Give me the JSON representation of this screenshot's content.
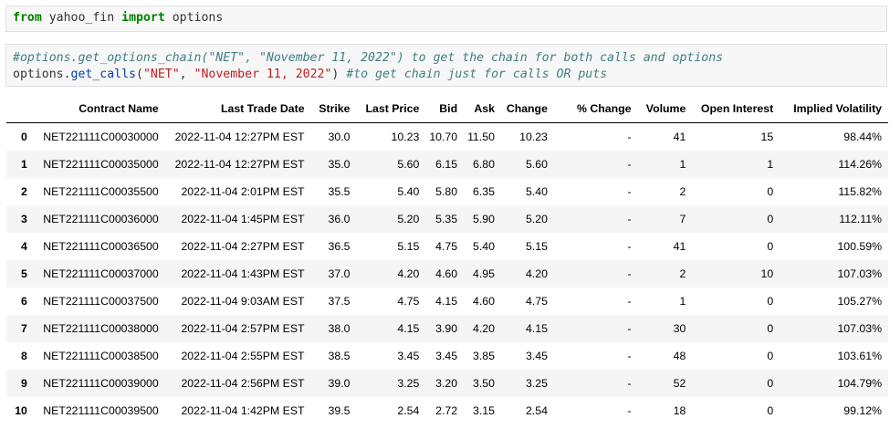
{
  "cells": {
    "import": {
      "kw_from": "from",
      "module": "yahoo_fin",
      "kw_import": "import",
      "name": "options"
    },
    "query": {
      "comment_line": "#options.get_options_chain(\"NET\", \"November 11, 2022\") to get the chain for both calls and options",
      "obj": "options",
      "dot": ".",
      "func": "get_calls",
      "open_paren": "(",
      "arg1": "\"NET\"",
      "sep": ", ",
      "arg2": "\"November 11, 2022\"",
      "close_paren": ") ",
      "comment_inline": "#to get chain just for calls OR puts"
    }
  },
  "table": {
    "columns": [
      "",
      "Contract Name",
      "Last Trade Date",
      "Strike",
      "Last Price",
      "Bid",
      "Ask",
      "Change",
      "% Change",
      "Volume",
      "Open Interest",
      "Implied Volatility"
    ],
    "rows": [
      [
        "0",
        "NET221111C00030000",
        "2022-11-04 12:27PM EST",
        "30.0",
        "10.23",
        "10.70",
        "11.50",
        "10.23",
        "-",
        "41",
        "15",
        "98.44%"
      ],
      [
        "1",
        "NET221111C00035000",
        "2022-11-04 12:27PM EST",
        "35.0",
        "5.60",
        "6.15",
        "6.80",
        "5.60",
        "-",
        "1",
        "1",
        "114.26%"
      ],
      [
        "2",
        "NET221111C00035500",
        "2022-11-04 2:01PM EST",
        "35.5",
        "5.40",
        "5.80",
        "6.35",
        "5.40",
        "-",
        "2",
        "0",
        "115.82%"
      ],
      [
        "3",
        "NET221111C00036000",
        "2022-11-04 1:45PM EST",
        "36.0",
        "5.20",
        "5.35",
        "5.90",
        "5.20",
        "-",
        "7",
        "0",
        "112.11%"
      ],
      [
        "4",
        "NET221111C00036500",
        "2022-11-04 2:27PM EST",
        "36.5",
        "5.15",
        "4.75",
        "5.40",
        "5.15",
        "-",
        "41",
        "0",
        "100.59%"
      ],
      [
        "5",
        "NET221111C00037000",
        "2022-11-04 1:43PM EST",
        "37.0",
        "4.20",
        "4.60",
        "4.95",
        "4.20",
        "-",
        "2",
        "10",
        "107.03%"
      ],
      [
        "6",
        "NET221111C00037500",
        "2022-11-04 9:03AM EST",
        "37.5",
        "4.75",
        "4.15",
        "4.60",
        "4.75",
        "-",
        "1",
        "0",
        "105.27%"
      ],
      [
        "7",
        "NET221111C00038000",
        "2022-11-04 2:57PM EST",
        "38.0",
        "4.15",
        "3.90",
        "4.20",
        "4.15",
        "-",
        "30",
        "0",
        "107.03%"
      ],
      [
        "8",
        "NET221111C00038500",
        "2022-11-04 2:55PM EST",
        "38.5",
        "3.45",
        "3.45",
        "3.85",
        "3.45",
        "-",
        "48",
        "0",
        "103.61%"
      ],
      [
        "9",
        "NET221111C00039000",
        "2022-11-04 2:56PM EST",
        "39.0",
        "3.25",
        "3.20",
        "3.50",
        "3.25",
        "-",
        "52",
        "0",
        "104.79%"
      ],
      [
        "10",
        "NET221111C00039500",
        "2022-11-04 1:42PM EST",
        "39.5",
        "2.54",
        "2.72",
        "3.15",
        "2.54",
        "-",
        "18",
        "0",
        "99.12%"
      ]
    ]
  }
}
